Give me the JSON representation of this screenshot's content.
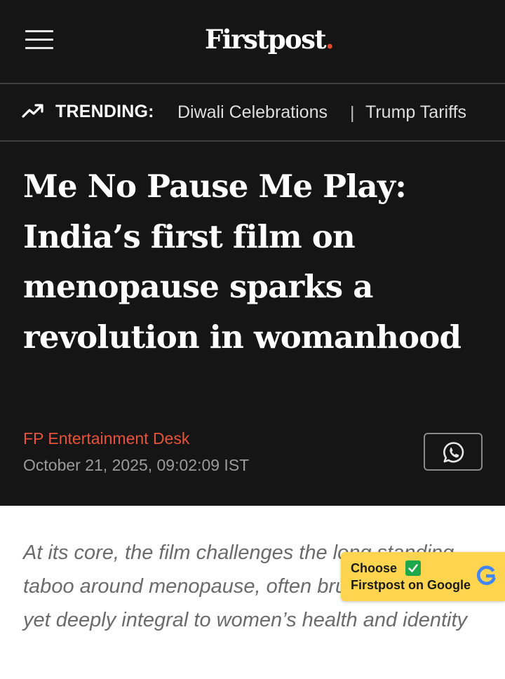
{
  "header": {
    "logo_text": "Firstpost",
    "logo_dot": ".",
    "brand_color": "#e04b2e",
    "menu_icon": "hamburger-menu-icon"
  },
  "trending": {
    "icon": "trending-up-icon",
    "label": "TRENDING:",
    "items": [
      "Diwali Celebrations",
      "Trump Tariffs"
    ],
    "separator": "|"
  },
  "article": {
    "headline": "Me No Pause Me Play: India’s first film on menopause sparks a revolution in womanhood",
    "author": "FP Entertainment Desk",
    "published": "October 21, 2025, 09:02:09 IST",
    "share_icon": "whatsapp-icon",
    "summary": "At its core, the film challenges the long standing taboo around menopause, often brushed aside, yet deeply integral to women’s health and identity"
  },
  "google_cta": {
    "line1": "Choose",
    "line2": "Firstpost on Google",
    "check_icon": "checkbox-checked-icon",
    "logo_icon": "google-g-icon",
    "background": "#ffd54f"
  },
  "colors": {
    "dark_bg": "#151515",
    "author_red": "#e5533c"
  }
}
